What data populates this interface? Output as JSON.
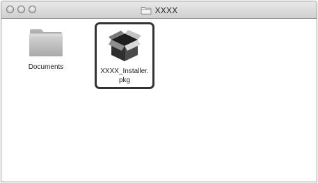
{
  "window": {
    "title": "XXXX",
    "title_icon": "folder-icon"
  },
  "items": [
    {
      "label": "Documents",
      "icon": "folder-icon"
    },
    {
      "label": "XXXX_Installer.pkg",
      "icon": "package-icon",
      "highlighted": true
    }
  ]
}
